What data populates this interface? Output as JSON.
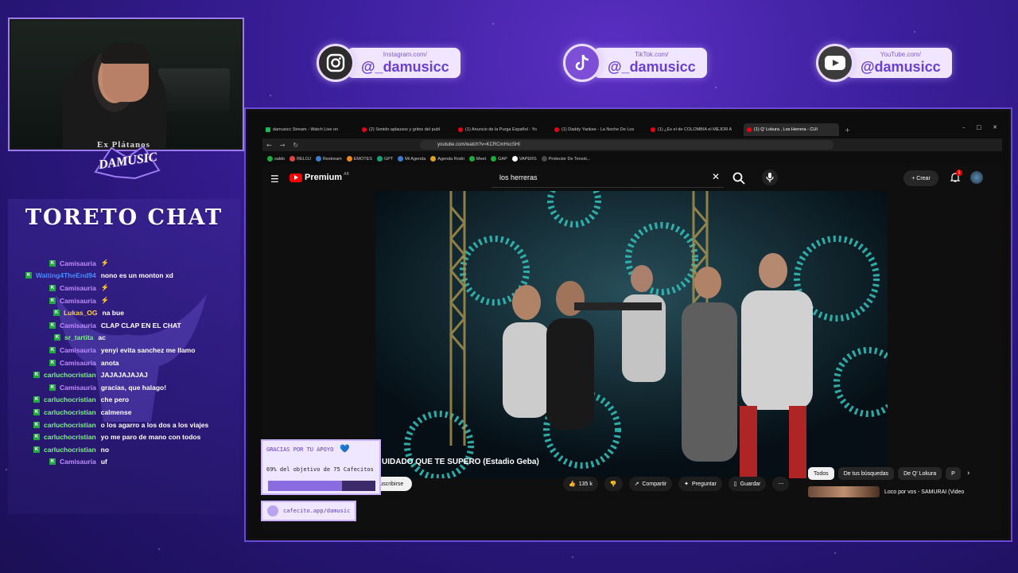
{
  "socials": [
    {
      "site": "Instagram.com/",
      "handle": "@_damusicc",
      "icon": "instagram-icon"
    },
    {
      "site": "TikTok.com/",
      "handle": "@_damusicc",
      "icon": "tiktok-icon"
    },
    {
      "site": "YouTube.com/",
      "handle": "@damusicc",
      "icon": "youtube-icon"
    }
  ],
  "webcam": {
    "shirt_text": "Ex Plátanos"
  },
  "streamer_logo": {
    "text": "DAMUSIC"
  },
  "chat": {
    "title": "TORETO CHAT",
    "messages": [
      {
        "user": "Camisauria",
        "text": "⚡",
        "color": "#c08cff"
      },
      {
        "user": "Waiting4TheEnd94",
        "text": "nono es un monton xd",
        "color": "#4a8cff"
      },
      {
        "user": "Camisauria",
        "text": "⚡",
        "color": "#c08cff"
      },
      {
        "user": "Camisauria",
        "text": "⚡",
        "color": "#c08cff"
      },
      {
        "user": "Lukas_OG",
        "text": "na bue",
        "color": "#ffd04a"
      },
      {
        "user": "Camisauria",
        "text": "CLAP CLAP EN EL CHAT",
        "color": "#c08cff"
      },
      {
        "user": "sr_tartita",
        "text": "ac",
        "color": "#7ff08a"
      },
      {
        "user": "Camisauria",
        "text": "yenyi evita sanchez me llamo",
        "color": "#c08cff"
      },
      {
        "user": "Camisauria",
        "text": "anota",
        "color": "#c08cff"
      },
      {
        "user": "carluchocristian",
        "text": "JAJAJAJAJAJ",
        "color": "#7ff08a"
      },
      {
        "user": "Camisauria",
        "text": "gracias, que halago!",
        "color": "#c08cff"
      },
      {
        "user": "carluchocristian",
        "text": "che pero",
        "color": "#7ff08a"
      },
      {
        "user": "carluchocristian",
        "text": "calmense",
        "color": "#7ff08a"
      },
      {
        "user": "carluchocristian",
        "text": "o los agarro a los dos a los viajes",
        "color": "#7ff08a"
      },
      {
        "user": "carluchocristian",
        "text": "yo me paro de mano con todos",
        "color": "#7ff08a"
      },
      {
        "user": "carluchocristian",
        "text": "no",
        "color": "#7ff08a"
      },
      {
        "user": "Camisauria",
        "text": "uf",
        "color": "#c08cff"
      }
    ]
  },
  "browser": {
    "tabs": [
      {
        "label": "damusicc Stream - Watch Live on",
        "icon": "twitch",
        "active": false
      },
      {
        "label": "(2) Sonido aplausos y gritos del publ",
        "icon": "youtube",
        "active": false
      },
      {
        "label": "(1) Anuncio de la Purga Español - Yo",
        "icon": "youtube",
        "active": false
      },
      {
        "label": "(1) Daddy Yankee - La Noche De Los",
        "icon": "youtube",
        "active": false
      },
      {
        "label": "(1) ¿Es el de COLOMBIA el MEJOR A",
        "icon": "youtube",
        "active": false
      },
      {
        "label": "(1) Q' Lokura , Los Herrera - CUI",
        "icon": "youtube",
        "active": true
      }
    ],
    "url": "youtube.com/watch?v=KCRCmHxcSHI",
    "bookmarks": [
      "saldo",
      "RELOJ",
      "Restream",
      "EMOTES",
      "GPT",
      "Mi Agenda",
      "Agenda Rodri",
      "Meet",
      "GAP",
      "VAPERS",
      "Protector De Tensió..."
    ]
  },
  "youtube": {
    "logo_text": "Premium",
    "logo_region": "AR",
    "search_value": "los herreras",
    "create_label": "Crear",
    "bell_count": "1",
    "video_title": "UIDADO QUE TE SUPERO (Estadio Geba)",
    "subscribe_label": "Suscribirse",
    "likes": "135 k",
    "share_label": "Compartir",
    "ask_label": "Preguntar",
    "save_label": "Guardar",
    "chips": [
      {
        "label": "Todos",
        "active": true
      },
      {
        "label": "De tus búsquedas",
        "active": false
      },
      {
        "label": "De Q' Lokura",
        "active": false
      },
      {
        "label": "P",
        "active": false
      }
    ],
    "reco_title": "Loco por vos - SAMURAI (Video"
  },
  "donation": {
    "title": "GRACIAS POR TU APOYO",
    "goal_text": "69% del objetivo de 75 Cafecitos",
    "progress": 0.69,
    "link": "cafecito.app/damusic"
  },
  "colors": {
    "accent": "#6a3fd6",
    "youtube_red": "#ff0000",
    "twitch_badge": "#1eaa3c"
  }
}
